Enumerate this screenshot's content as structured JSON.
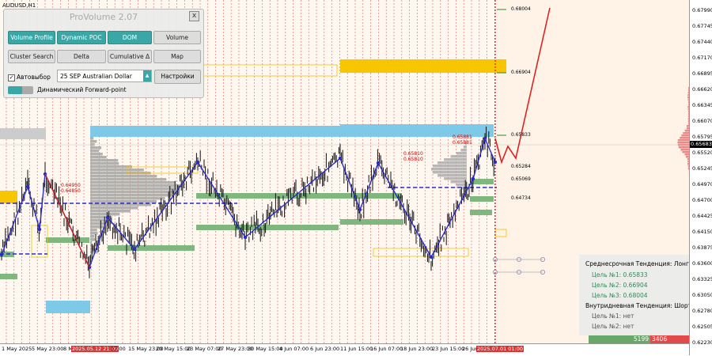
{
  "symbol": "AUDUSD,H1",
  "current_price": "0.65683",
  "price_axis": [
    "0.67990",
    "0.67745",
    "0.67440",
    "0.67170",
    "0.66895",
    "0.66620",
    "0.66345",
    "0.66070",
    "0.65795",
    "0.65520",
    "0.65245",
    "0.64970",
    "0.64700",
    "0.64425",
    "0.64150",
    "0.63875",
    "0.63600",
    "0.63325",
    "0.63050",
    "0.62780",
    "0.62505",
    "0.62230"
  ],
  "time_axis": [
    {
      "label": "1 May 2025",
      "hl": false
    },
    {
      "label": "5 May 23:00",
      "hl": false
    },
    {
      "label": "8 May",
      "hl": false
    },
    {
      "label": "2025.05.12 21:00",
      "hl": true
    },
    {
      "label": "07:00",
      "hl": false
    },
    {
      "label": "15 May 23:00",
      "hl": false
    },
    {
      "label": "20 May 15:00",
      "hl": false
    },
    {
      "label": "23 May 07:00",
      "hl": false
    },
    {
      "label": "27 May 23:00",
      "hl": false
    },
    {
      "label": "30 May 15:00",
      "hl": false
    },
    {
      "label": "4 Jun 07:00",
      "hl": false
    },
    {
      "label": "6 Jun 23:00",
      "hl": false
    },
    {
      "label": "11 Jun 15:00",
      "hl": false
    },
    {
      "label": "16 Jun 07:00",
      "hl": false
    },
    {
      "label": "18 Jun 23:00",
      "hl": false
    },
    {
      "label": "23 Jun 15:00",
      "hl": false
    },
    {
      "label": "26 Jun",
      "hl": false
    },
    {
      "label": "2025.07.01 01:00",
      "hl": true
    }
  ],
  "levels": {
    "target3": "0.68004",
    "target2": "0.66904",
    "target1": "0.65833",
    "l1": "0.65284",
    "l2": "0.65069",
    "l3": "0.64734",
    "box_a1": "0.65810",
    "box_a2": "0.65810",
    "box_b1": "0.64950",
    "box_b2": "0.64850",
    "box_c1": "0.65881",
    "box_c2": "0.65881"
  },
  "panel": {
    "title": "ProVolume 2.07",
    "close": "x",
    "buttons": [
      {
        "label": "Volume Profile",
        "on": true
      },
      {
        "label": "Dynamic POC",
        "on": true
      },
      {
        "label": "DOM",
        "on": true
      },
      {
        "label": "Volume",
        "on": false
      },
      {
        "label": "Cluster Search",
        "on": false
      },
      {
        "label": "Delta",
        "on": false
      },
      {
        "label": "Cumulative Δ",
        "on": false
      },
      {
        "label": "Map",
        "on": false
      }
    ],
    "auto_select": "Автовыбор",
    "auto_checked": "✓",
    "instrument": "25 SEP Australian Dollar",
    "settings": "Настройки",
    "forward_point": "Динамический Forward-point"
  },
  "trend": {
    "medium": "Среднесрочная Тенденция: Лонг",
    "m_t1": "Цель №1: 0.65833",
    "m_t2": "Цель №2: 0.66904",
    "m_t3": "Цель №3: 0.68004",
    "intraday": "Внутридневная Тенденция: Шорт",
    "i_t1": "Цель №1: нет",
    "i_t2": "Цель №2: нет"
  },
  "volume": {
    "buy": "5199",
    "sell": "3406"
  },
  "colors": {
    "blue_zone": "#7ec8e8",
    "yellow_zone": "#f7c600",
    "green_zone": "#7fb77f",
    "zigzag": "#2a2acc",
    "forecast": "#dd2222"
  },
  "chart_data": {
    "type": "line",
    "title": "",
    "series": [
      {
        "name": "zigzag",
        "values": [
          0.6398,
          0.649,
          0.644,
          0.6355,
          0.643,
          0.6385,
          0.653,
          0.641,
          0.65,
          0.652,
          0.637,
          0.6488,
          0.6566,
          0.653
        ]
      }
    ],
    "forecast": [
      0.6566,
      0.653,
      0.656,
      0.68
    ],
    "ylim": [
      0.6223,
      0.6799
    ]
  }
}
